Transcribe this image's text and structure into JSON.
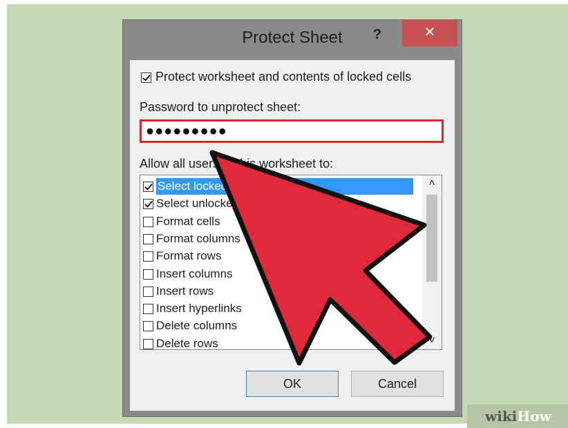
{
  "dialog": {
    "title": "Protect Sheet",
    "help_glyph": "?",
    "close_glyph": "✕",
    "protect_checkbox": {
      "label": "Protect worksheet and contents of locked cells",
      "checked": true
    },
    "password_label": "Password to unprotect sheet:",
    "password_value": "●●●●●●●●●",
    "allow_label": "Allow all users of this worksheet to:",
    "permissions": [
      {
        "label": "Select locked cells",
        "checked": true,
        "selected": true
      },
      {
        "label": "Select unlocked cells",
        "checked": true,
        "selected": false
      },
      {
        "label": "Format cells",
        "checked": false,
        "selected": false
      },
      {
        "label": "Format columns",
        "checked": false,
        "selected": false
      },
      {
        "label": "Format rows",
        "checked": false,
        "selected": false
      },
      {
        "label": "Insert columns",
        "checked": false,
        "selected": false
      },
      {
        "label": "Insert rows",
        "checked": false,
        "selected": false
      },
      {
        "label": "Insert hyperlinks",
        "checked": false,
        "selected": false
      },
      {
        "label": "Delete columns",
        "checked": false,
        "selected": false
      },
      {
        "label": "Delete rows",
        "checked": false,
        "selected": false
      }
    ],
    "scroll_up_glyph": "˄",
    "scroll_down_glyph": "˅",
    "ok_label": "OK",
    "cancel_label": "Cancel"
  },
  "watermark": {
    "part1": "wiki",
    "part2": "How"
  },
  "colors": {
    "background": "#c7d9b4",
    "close": "#c75050",
    "highlight": "#e0242c",
    "selection": "#3399ff",
    "arrow": "#e0293b"
  }
}
